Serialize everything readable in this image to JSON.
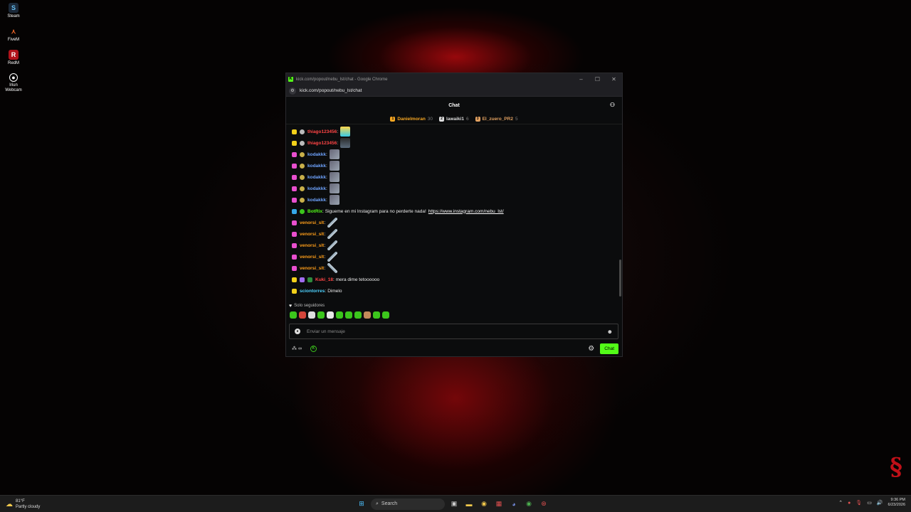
{
  "desktop": {
    "icons": [
      {
        "label": "Steam",
        "icon": "steam-icon"
      },
      {
        "label": "FiveM",
        "icon": "fivem-icon"
      },
      {
        "label": "RedM",
        "icon": "redm-icon"
      },
      {
        "label": "Iriun Webcam",
        "icon": "webcam-icon"
      }
    ]
  },
  "browser": {
    "title": "kick.com/popout/nebu_lst/chat - Google Chrome",
    "url": "kick.com/popout/nebu_lst/chat"
  },
  "chat": {
    "header": "Chat",
    "top_gifters": [
      {
        "name": "Danielmoran",
        "count": "30",
        "color": "#f5a623"
      },
      {
        "name": "lawaiki1",
        "count": "6",
        "color": "#dddddd"
      },
      {
        "name": "El_zuero_PR2",
        "count": "5",
        "color": "#e0a060"
      }
    ],
    "messages": [
      {
        "user": "thiago123456",
        "text": "",
        "color": "#ff4545"
      },
      {
        "user": "thiago123456",
        "text": "",
        "color": "#ff4545"
      },
      {
        "user": "kodakkk",
        "text": "",
        "color": "#6fa4ff"
      },
      {
        "user": "kodakkk",
        "text": "",
        "color": "#6fa4ff"
      },
      {
        "user": "kodakkk",
        "text": "",
        "color": "#6fa4ff"
      },
      {
        "user": "kodakkk",
        "text": "",
        "color": "#6fa4ff"
      },
      {
        "user": "kodakkk",
        "text": "",
        "color": "#6fa4ff"
      },
      {
        "user": "BotRix",
        "text": "Sigueme en mi Instagram para no perderte nada!",
        "link": "https://www.instagram.com/nebu_lst/",
        "color": "#53fc18"
      },
      {
        "user": "venorsi_slt",
        "text": "",
        "color": "#ff9f1a"
      },
      {
        "user": "venorsi_slt",
        "text": "",
        "color": "#ff9f1a"
      },
      {
        "user": "venorsi_slt",
        "text": "",
        "color": "#ff9f1a"
      },
      {
        "user": "venorsi_slt",
        "text": "",
        "color": "#ff9f1a"
      },
      {
        "user": "venorsi_slt",
        "text": "",
        "color": "#ff9f1a"
      },
      {
        "user": "Kuki_18",
        "text": "mera dime tetoooooo",
        "color": "#ff4545"
      },
      {
        "user": "sciontorres",
        "text": "Dimelo",
        "color": "#4fd3ff"
      }
    ],
    "followers_only": "Solo seguidores",
    "input_placeholder": "Enviar un mensaje",
    "points": "∞",
    "send_label": "Chat"
  },
  "taskbar": {
    "temperature": "81°F",
    "weather": "Partly cloudy",
    "search": "Search",
    "time": "9:36 PM",
    "date": "6/23/2026"
  },
  "colors": {
    "kick_green": "#53fc18",
    "wallpaper_red": "#c01018"
  }
}
